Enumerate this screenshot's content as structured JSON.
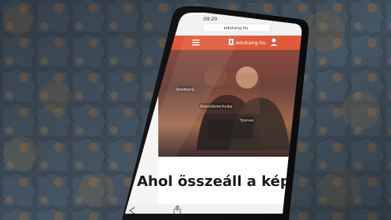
{
  "phone": {
    "status_time": "09:20",
    "url": "edukang.hu",
    "app_name": "edukang.hu",
    "tags": {
      "left": "Adatbázis",
      "center": "Számítástechnika",
      "right": "Szerver"
    },
    "headline": "Ahol összeáll a kép"
  },
  "colors": {
    "brand_orange": "#e05a3a",
    "puzzle_blue": "#3e4b57",
    "puzzle_gold": "#b77a38"
  },
  "icons": {
    "menu": "hamburger-menu-icon",
    "logo": "brand-logo-icon",
    "user": "user-icon",
    "back": "chevron-left-icon",
    "share": "share-icon",
    "aa": "reader-aa-icon",
    "reload": "reload-icon"
  }
}
